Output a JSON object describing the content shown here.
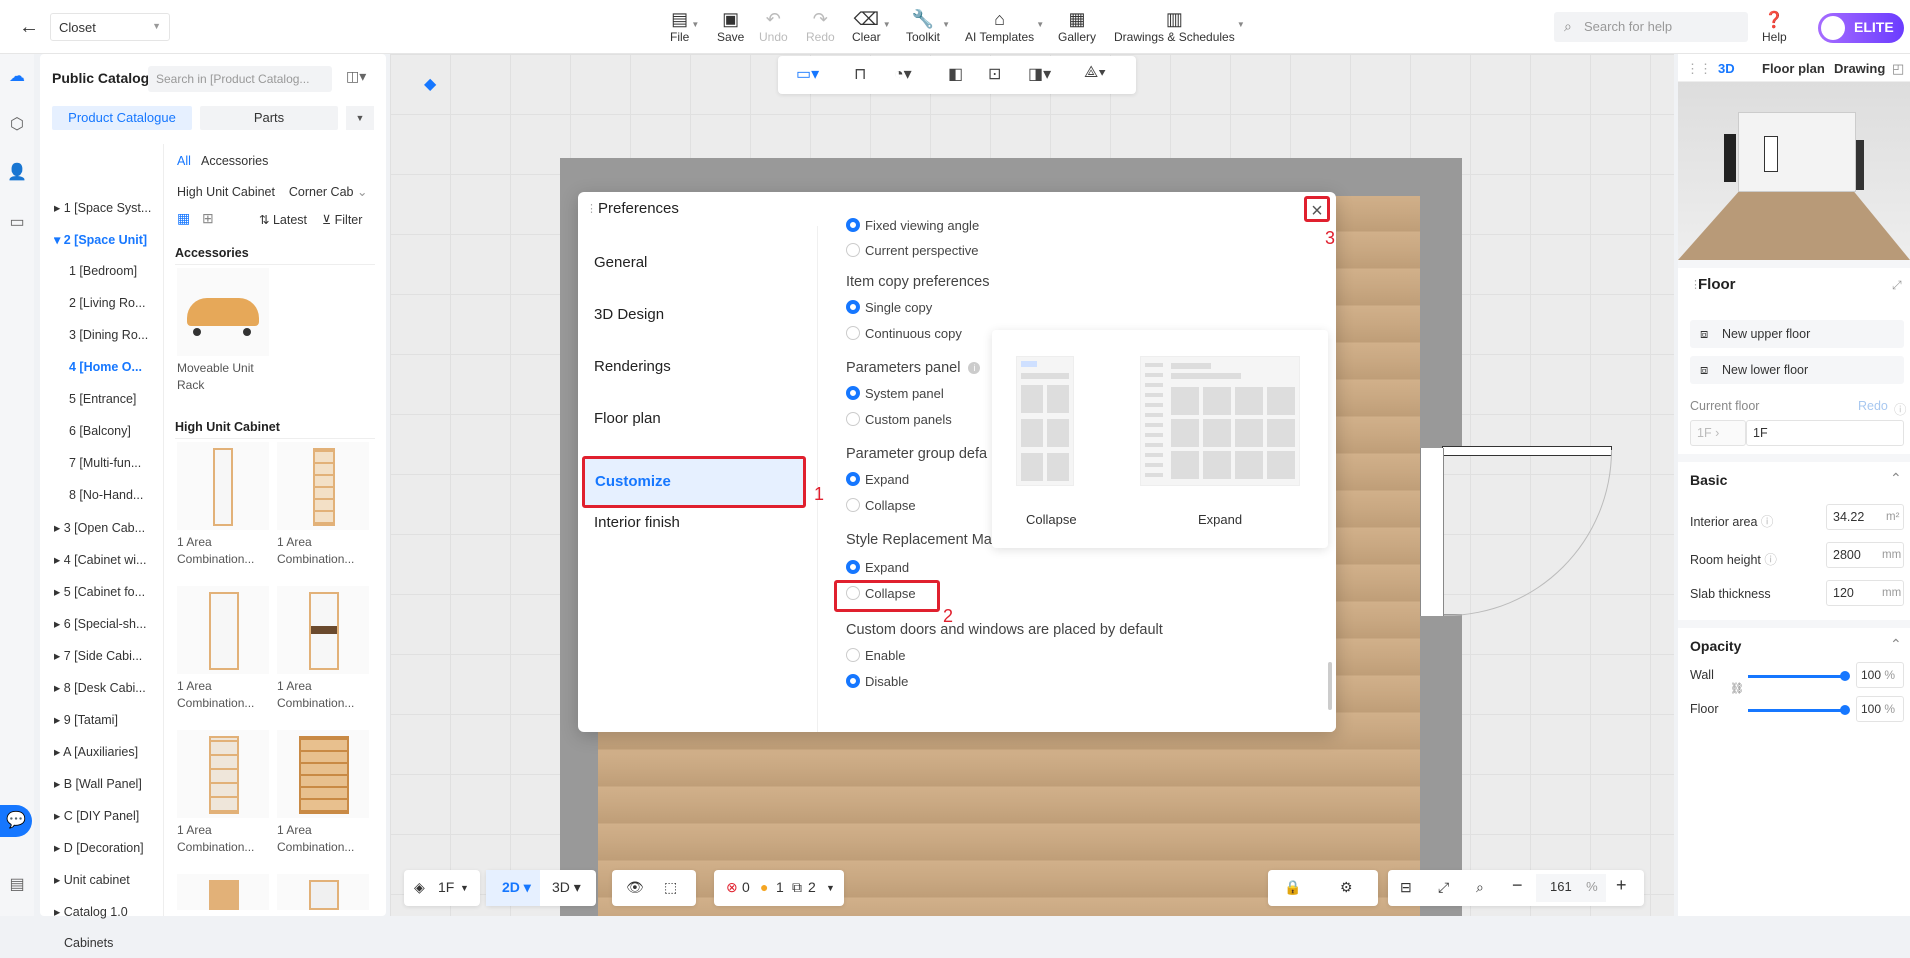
{
  "topbar": {
    "project": "Closet",
    "file": "File",
    "save": "Save",
    "undo": "Undo",
    "redo": "Redo",
    "clear": "Clear",
    "toolkit": "Toolkit",
    "ai_templates": "AI Templates",
    "gallery": "Gallery",
    "drawings": "Drawings & Schedules",
    "search_placeholder": "Search for help",
    "help": "Help",
    "elite": "ELITE"
  },
  "catalog": {
    "title": "Public Catalog",
    "search_placeholder": "Search in  [Product Catalog...",
    "tabs": [
      "Product Catalogue",
      "Parts"
    ],
    "tree": [
      "1 [Space Syst...",
      "2 [Space Unit]",
      "1 [Bedroom]",
      "2 [Living Ro...",
      "3 [Dining Ro...",
      "4 [Home O...",
      "5 [Entrance]",
      "6 [Balcony]",
      "7 [Multi-fun...",
      "8 [No-Hand...",
      "3 [Open Cab...",
      "4 [Cabinet wi...",
      "5 [Cabinet fo...",
      "6 [Special-sh...",
      "7 [Side Cabi...",
      "8 [Desk Cabi...",
      "9 [Tatami]",
      "A [Auxiliaries]",
      "B [Wall Panel]",
      "C [DIY Panel]",
      "D [Decoration]",
      "Unit cabinet",
      "Catalog 1.0",
      "Cabinets"
    ],
    "filter_all": "All",
    "filter_accessories": "Accessories",
    "filter_high": "High Unit Cabinet",
    "filter_corner": "Corner Cab",
    "latest": "Latest",
    "filter": "Filter",
    "sec_accessories": "Accessories",
    "sec_high": "High Unit Cabinet",
    "p_rack_1": "Moveable Unit",
    "p_rack_2": "Rack",
    "p_combo_1": "1 Area",
    "p_combo_2": "Combination..."
  },
  "toolbar_bottom": {
    "floor": "1F",
    "mode2d": "2D",
    "mode3d": "3D",
    "err": "0",
    "warn": "1",
    "layers": "2",
    "zoom": "161",
    "pct": "%"
  },
  "right": {
    "tab3d": "3D",
    "tab_floor": "Floor plan",
    "tab_drawing": "Drawing",
    "floor": "Floor",
    "new_upper": "New upper floor",
    "new_lower": "New lower floor",
    "current_floor": "Current floor",
    "redo": "Redo",
    "cur_sel": "1F",
    "cur_val": "1F",
    "basic": "Basic",
    "interior_area": "Interior area",
    "interior_val": "34.22",
    "m2": "m²",
    "room_height": "Room height",
    "room_val": "2800",
    "mm": "mm",
    "slab": "Slab thickness",
    "slab_val": "120",
    "opacity": "Opacity",
    "wall": "Wall",
    "wall_val": "100",
    "floor_lbl": "Floor",
    "floor_val": "100",
    "pct": "%"
  },
  "dialog": {
    "title": "Preferences",
    "nav": [
      "General",
      "3D Design",
      "Renderings",
      "Floor plan",
      "Customize",
      "Interior finish"
    ],
    "opt_fixed": "Fixed viewing angle",
    "opt_current": "Current perspective",
    "q_copy": "Item copy preferences",
    "opt_single": "Single copy",
    "opt_cont": "Continuous copy",
    "q_params": "Parameters panel",
    "opt_system": "System panel",
    "opt_custom": "Custom panels",
    "q_group": "Parameter group defa",
    "opt_expand": "Expand",
    "opt_collapse": "Collapse",
    "q_style": "Style Replacement Material Library Directory",
    "q_doors": "Custom doors and windows are placed by default",
    "opt_enable": "Enable",
    "opt_disable": "Disable",
    "pop_collapse": "Collapse",
    "pop_expand": "Expand"
  },
  "annotations": {
    "a1": "1",
    "a2": "2",
    "a3": "3"
  }
}
